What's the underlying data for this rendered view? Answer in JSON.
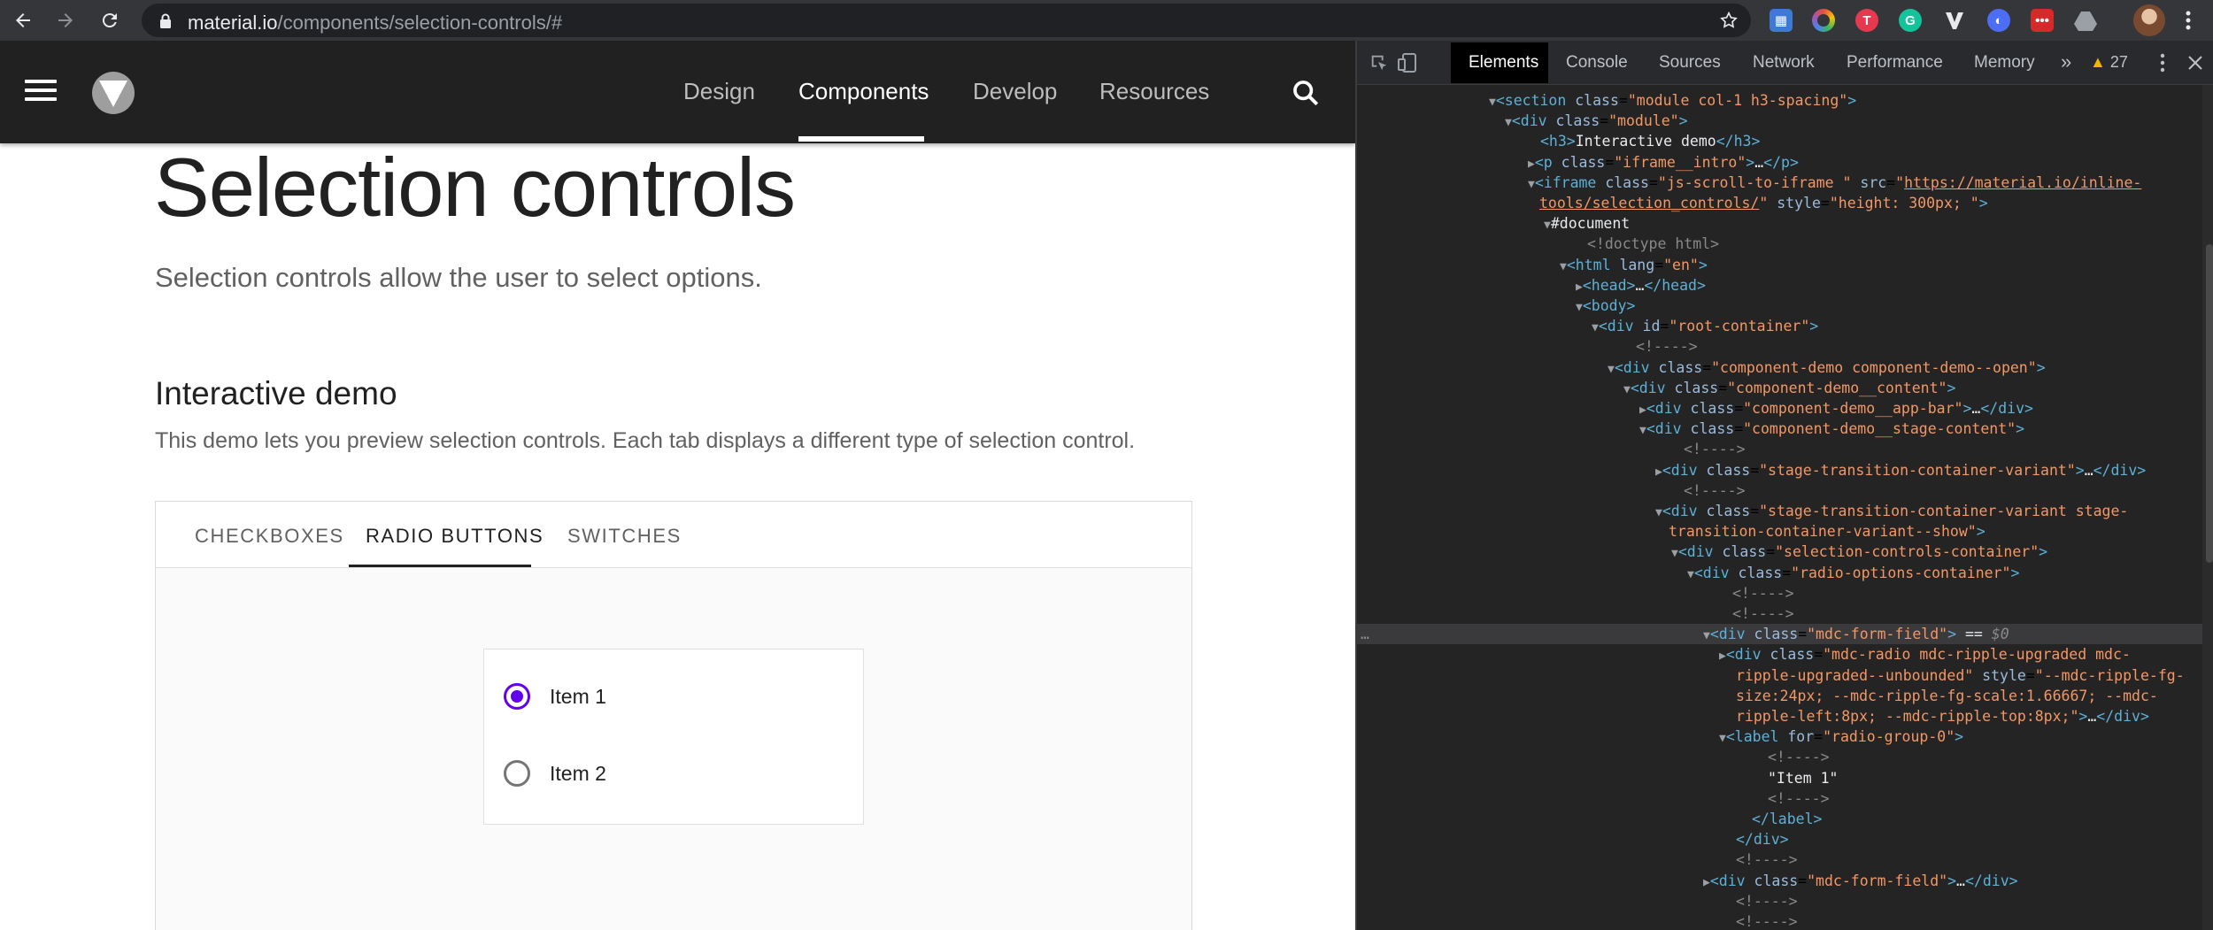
{
  "browser": {
    "url_host": "material.io",
    "url_path": "/components/selection-controls/#",
    "extensions": [
      "bookmarks-ext-icon",
      "color-ring-ext-icon",
      "t-ext-icon",
      "grammarly-ext-icon",
      "v-ext-icon",
      "chrome-ext-icon",
      "dots-ext-icon",
      "drive-ext-icon"
    ]
  },
  "site": {
    "nav": [
      "Design",
      "Components",
      "Develop",
      "Resources"
    ],
    "active_nav": "Components"
  },
  "page": {
    "title": "Selection controls",
    "subtitle": "Selection controls allow the user to select options.",
    "section_title": "Interactive demo",
    "intro": "This demo lets you preview selection controls. Each tab displays a different type of selection control."
  },
  "demo": {
    "tabs": [
      "CHECKBOXES",
      "RADIO BUTTONS",
      "SWITCHES"
    ],
    "active_tab": "RADIO BUTTONS",
    "options": [
      {
        "label": "Item 1",
        "checked": true
      },
      {
        "label": "Item 2",
        "checked": false
      }
    ],
    "accent_color": "#6200ee"
  },
  "devtools": {
    "tabs": [
      "Elements",
      "Console",
      "Sources",
      "Network",
      "Performance",
      "Memory"
    ],
    "active_tab": "Elements",
    "more": "»",
    "warnings": "27"
  }
}
